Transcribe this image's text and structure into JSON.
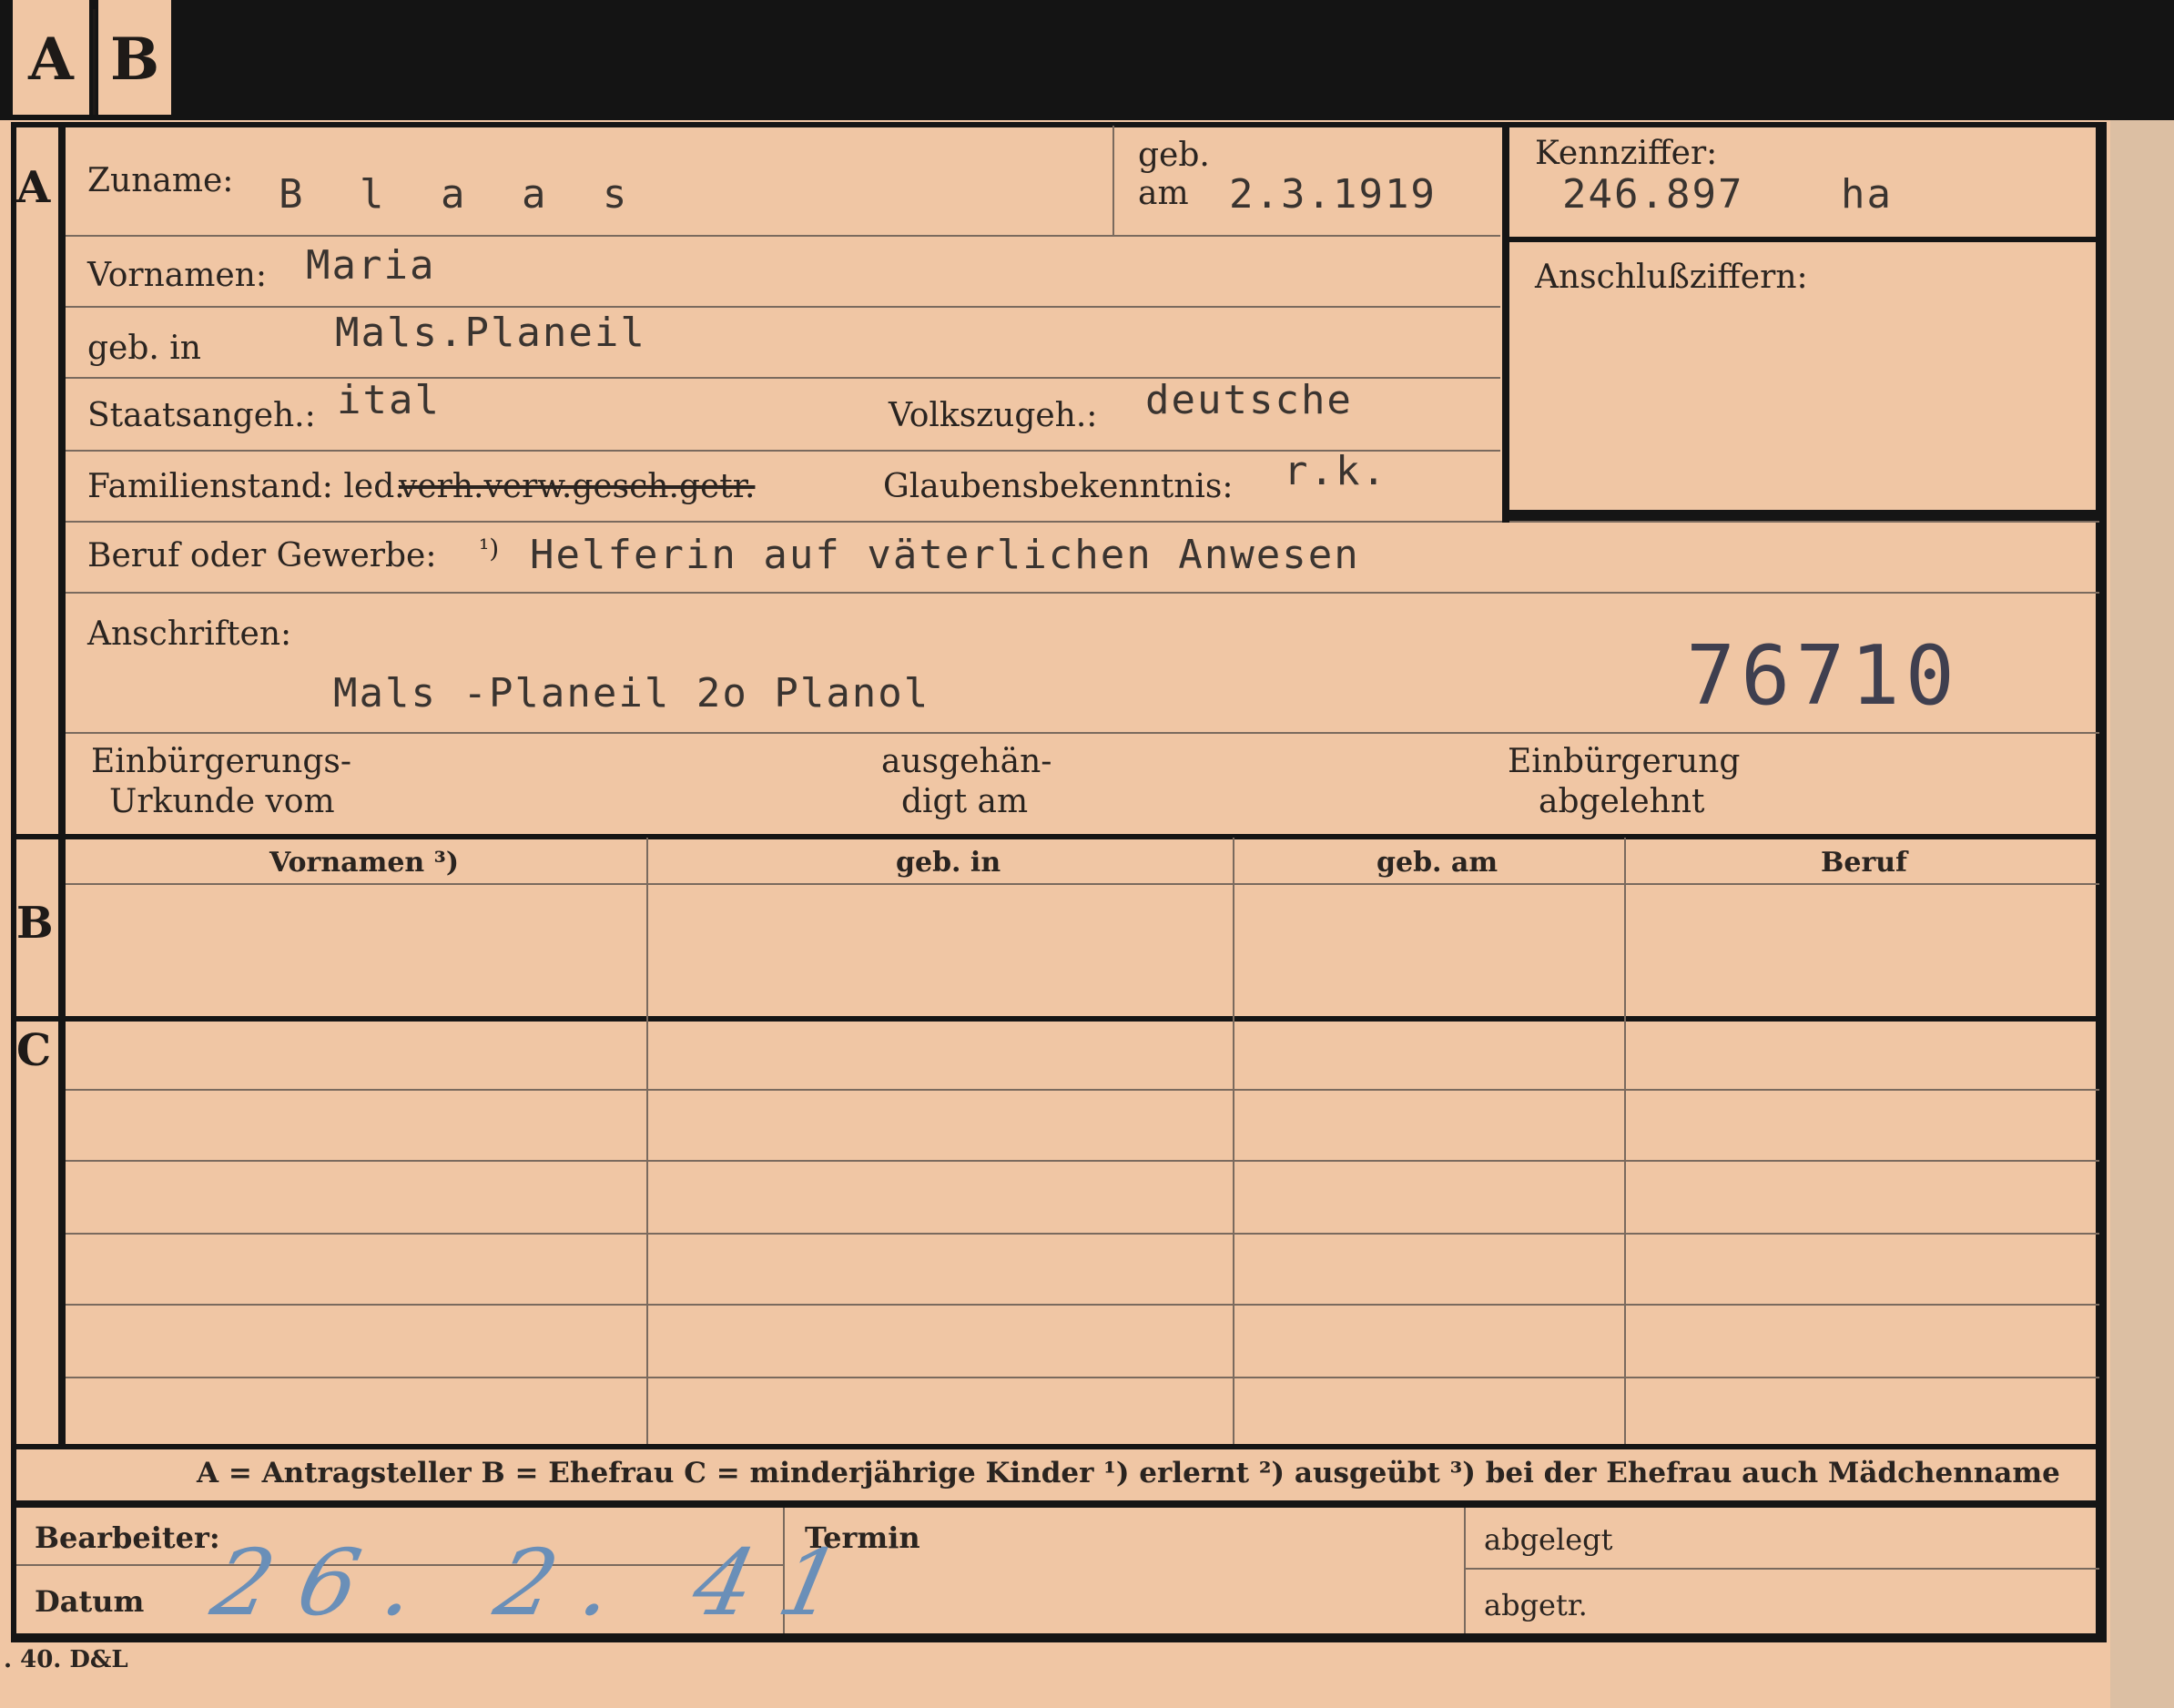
{
  "tabs": {
    "a": "A",
    "b": "B"
  },
  "sections": {
    "a": "A",
    "b": "B",
    "c": "C"
  },
  "labels": {
    "zuname": "Zuname:",
    "geb": "geb.",
    "am": "am",
    "kennziffer": "Kennziffer:",
    "vornamen": "Vornamen:",
    "anschlussziffern": "Anschlußziffern:",
    "geb_in": "geb. in",
    "staatsangeh": "Staatsangeh.:",
    "volkszugeh": "Volkszugeh.:",
    "familienstand": "Familienstand: led.",
    "familienstand_crossed": "verh.verw.gesch.getr.",
    "glaubensbekenntnis": "Glaubensbekenntnis:",
    "beruf": "Beruf oder Gewerbe:",
    "beruf_note": "¹)",
    "anschriften": "Anschriften:",
    "einbuergerungs_1": "Einbürgerungs-",
    "einbuergerungs_2": "Urkunde vom",
    "ausgehaen_1": "ausgehän-",
    "ausgehaen_2": "digt am",
    "einbuergerung_1": "Einbürgerung",
    "einbuergerung_2": "abgelehnt"
  },
  "values": {
    "zuname": "B l a a s",
    "geb_am": "2.3.1919",
    "kennziffer": "246.897",
    "kennziffer_suffix": "ha",
    "vornamen": "Maria",
    "geb_in": "Mals.Planeil",
    "staatsangeh": "ital",
    "volkszugeh": "deutsche",
    "glaubensbekenntnis": "r.k.",
    "beruf": "Helferin auf väterlichen Anwesen",
    "anschrift": "Mals -Planeil 2o Planol",
    "stamp_number": "76710"
  },
  "table": {
    "headers": [
      "Vornamen ³)",
      "geb. in",
      "geb. am",
      "Beruf"
    ]
  },
  "legend": "A = Antragsteller   B = Ehefrau   C = minderjährige Kinder   ¹) erlernt   ²) ausgeübt   ³) bei der Ehefrau auch Mädchenname",
  "footer": {
    "bearbeiter": "Bearbeiter:",
    "datum": "Datum",
    "datum_value": "26. 2. 41",
    "termin": "Termin",
    "abgelegt": "abgelegt",
    "abgetr": "abgetr.",
    "printer": ". 40. D&L"
  }
}
